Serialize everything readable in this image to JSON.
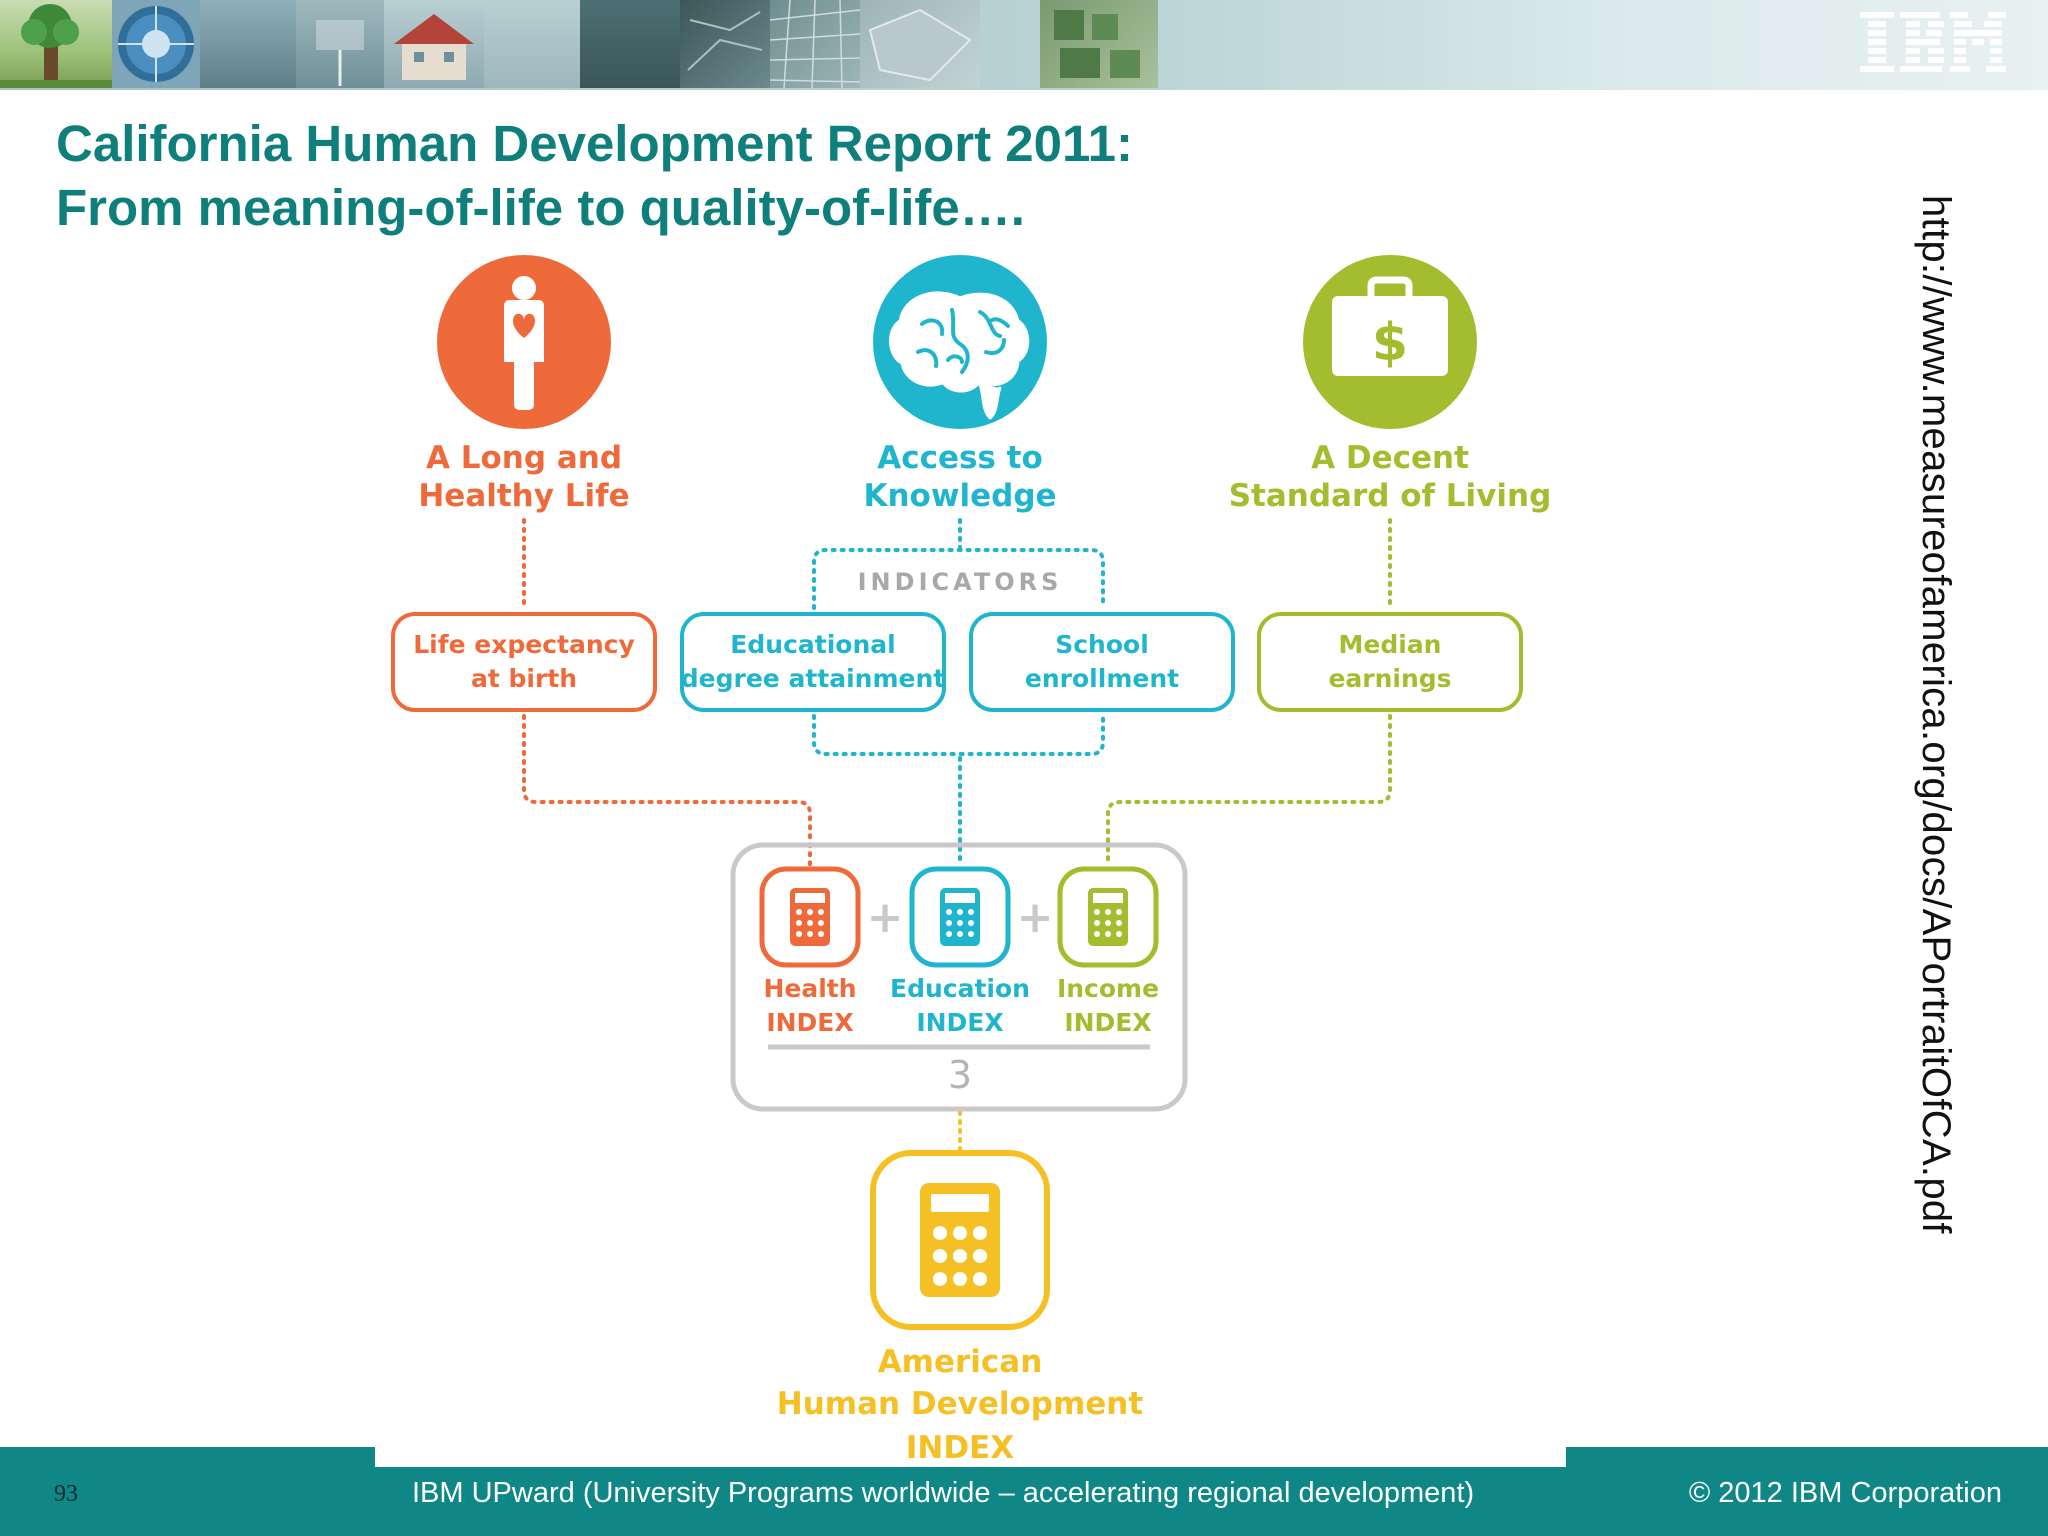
{
  "header": {
    "logo_text": "IBM",
    "banner_images": [
      "tree-photo",
      "wheel-diagram-photo",
      "city-photo",
      "wind-turbine-photo",
      "house-photo",
      "aerial-city-photo",
      "satellite-map-photo",
      "circuit-board-photo"
    ]
  },
  "title": {
    "line1": "California Human Development Report 2011:",
    "line2": "From meaning-of-life to quality-of-life…."
  },
  "source_url": "http://www.measureofamerica.org/docs/APortraitOfCA.pdf",
  "diagram": {
    "dimensions": [
      {
        "line1": "A Long and",
        "line2": "Healthy Life",
        "icon": "person-heart-icon",
        "color": "#ee6a3a"
      },
      {
        "line1": "Access to",
        "line2": "Knowledge",
        "icon": "brain-icon",
        "color": "#1fb5cc"
      },
      {
        "line1": "A Decent",
        "line2": "Standard of Living",
        "icon": "briefcase-dollar-icon",
        "color": "#a3bd2e"
      }
    ],
    "indicators_label": "INDICATORS",
    "indicators": [
      {
        "line1": "Life expectancy",
        "line2": "at birth",
        "color": "#ee6a3a"
      },
      {
        "line1": "Educational",
        "line2": "degree attainment",
        "color": "#1fb5cc"
      },
      {
        "line1": "School",
        "line2": "enrollment",
        "color": "#1fb5cc"
      },
      {
        "line1": "Median",
        "line2": "earnings",
        "color": "#a3bd2e"
      }
    ],
    "indices": [
      {
        "line1": "Health",
        "line2": "INDEX",
        "color": "#ee6a3a"
      },
      {
        "line1": "Education",
        "line2": "INDEX",
        "color": "#1fb5cc"
      },
      {
        "line1": "Income",
        "line2": "INDEX",
        "color": "#a3bd2e"
      }
    ],
    "plus": "+",
    "divisor": "3",
    "result": {
      "line1": "American",
      "line2": "Human Development",
      "line3": "INDEX",
      "color": "#f5c024"
    }
  },
  "footer": {
    "page_number": "93",
    "text": "IBM UPward (University Programs worldwide – accelerating regional development)",
    "copyright": "© 2012 IBM Corporation"
  },
  "colors": {
    "title": "#0f7f7b",
    "footer_bar": "#0f8786",
    "health": "#ee6a3a",
    "knowledge": "#1fb5cc",
    "living": "#a3bd2e",
    "result": "#f5c024",
    "neutral": "#c9c9c9"
  }
}
